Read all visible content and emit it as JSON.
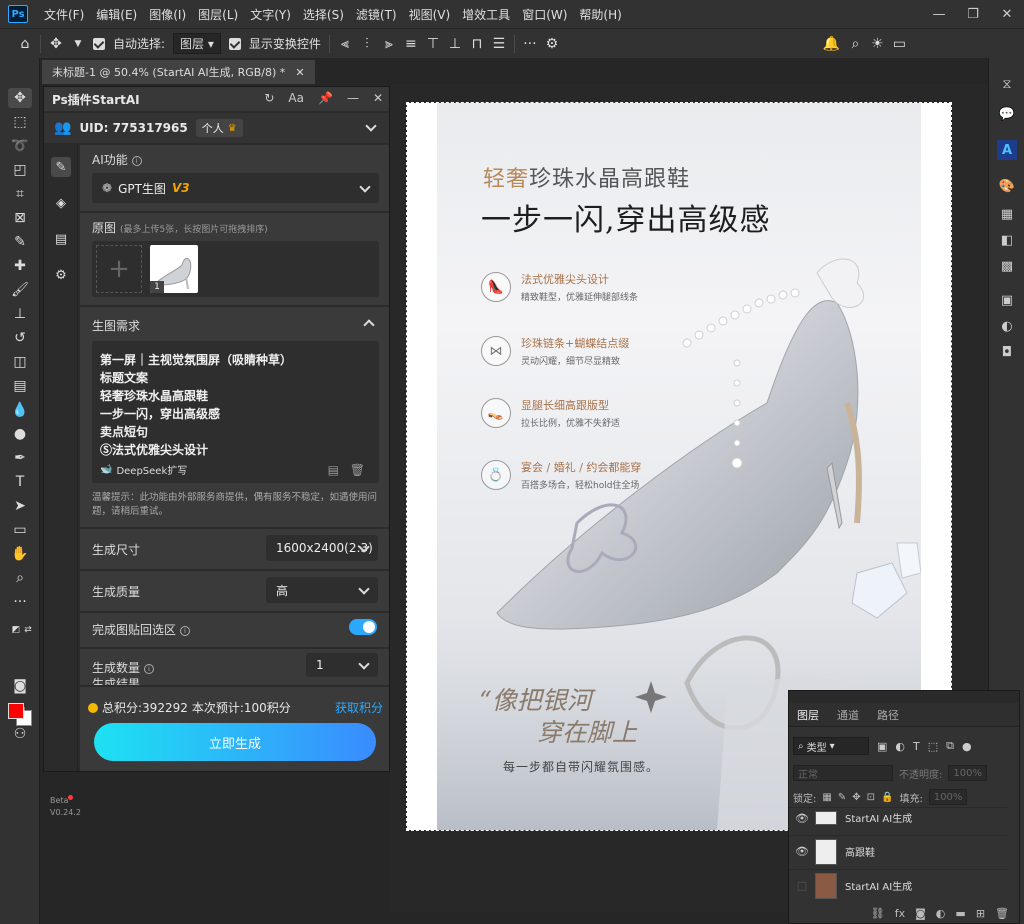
{
  "app": {
    "logo": "Ps"
  },
  "menu": [
    "文件(F)",
    "编辑(E)",
    "图像(I)",
    "图层(L)",
    "文字(Y)",
    "选择(S)",
    "滤镜(T)",
    "视图(V)",
    "增效工具",
    "窗口(W)",
    "帮助(H)"
  ],
  "options": {
    "auto_select_label": "自动选择:",
    "auto_select_value": "图层",
    "show_transform_label": "显示变换控件"
  },
  "document_tab": {
    "title": "未标题-1 @ 50.4% (StartAI AI生成, RGB/8) *"
  },
  "plugin": {
    "title": "Ps插件StartAI",
    "uid": "UID: 775317965",
    "plan": "个人",
    "ai_function_label": "AI功能",
    "model_name": "GPT生图",
    "model_version": "V3",
    "source_label": "原图",
    "source_hint": "(最多上传5张，长按图片可拖拽排序)",
    "thumb_index": "1",
    "requirements_label": "生图需求",
    "prompt_lines": [
      "第一屏｜主视觉氛围屏（吸睛种草）",
      "标题文案",
      "轻奢珍珠水晶高跟鞋",
      "一步一闪，穿出高级感",
      "卖点短句",
      "Ⓢ法式优雅尖头设计"
    ],
    "deepseek_label": "DeepSeek扩写",
    "tip": "温馨提示：此功能由外部服务商提供，偶有服务不稳定，如遇使用问题，请稍后重试。",
    "size_label": "生成尺寸",
    "size_value": "1600x2400(2:3)",
    "quality_label": "生成质量",
    "quality_value": "高",
    "paste_back_label": "完成图贴回选区",
    "count_label": "生成数量",
    "count_value": "1",
    "partial_label": "生成结果",
    "credits_text": "总积分:392292",
    "estimate_text": "本次预计:100积分",
    "get_credits": "获取积分",
    "generate_button": "立即生成",
    "beta": "Beta",
    "version": "V0.24.2"
  },
  "poster": {
    "subtitle_accent": "轻奢",
    "subtitle_rest": "珍珠水晶高跟鞋",
    "title": "一步一闪,穿出高级感",
    "features": [
      {
        "title": "法式优雅尖头设计",
        "desc": "精致鞋型，优雅延伸腿部线条",
        "icon": "shoe-icon"
      },
      {
        "title": "珍珠链条+蝴蝶结点缀",
        "desc": "灵动闪耀，细节尽显精致",
        "icon": "bow-icon"
      },
      {
        "title": "显腿长细高跟版型",
        "desc": "拉长比例，优雅不失舒适",
        "icon": "heel-icon"
      },
      {
        "title": "宴会 / 婚礼 / 约会都能穿",
        "desc": "百搭多场合，轻松hold住全场",
        "icon": "ring-icon"
      }
    ],
    "quote_line1": "“像把银河",
    "quote_line2": "穿在脚上",
    "quote_sub": "每一步都自带闪耀氛围感。"
  },
  "layers_panel": {
    "tabs": [
      "图层",
      "通道",
      "路径"
    ],
    "kind": "类型",
    "blend_mode": "正常",
    "opacity_label": "不透明度:",
    "opacity_value": "100%",
    "lock_label": "锁定:",
    "fill_label": "填充:",
    "fill_value": "100%",
    "layers": [
      "StartAI AI生成",
      "高跟鞋",
      "StartAI AI生成"
    ]
  },
  "colors": {
    "foreground": "#ff0000",
    "background": "#ffffff",
    "accent": "#2ca8ff"
  }
}
